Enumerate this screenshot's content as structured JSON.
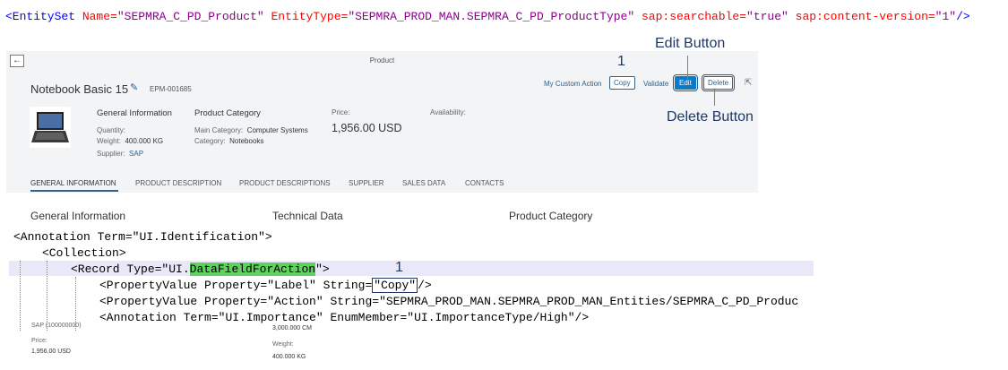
{
  "top_xml": {
    "tag": "<EntitySet",
    "name_attr": "Name=",
    "name_val": "\"SEPMRA_C_PD_Product\"",
    "type_attr": "EntityType=",
    "type_val": "\"SEPMRA_PROD_MAN.SEPMRA_C_PD_ProductType\"",
    "search_attr": "sap:searchable=",
    "search_val": "\"true\"",
    "version_attr": "sap:content-version=",
    "version_val": "\"1\"",
    "close": "/>"
  },
  "fiori": {
    "back_icon": "←",
    "page_header": "Product",
    "object_title": "Notebook Basic 15",
    "edit_pen_icon": "✎",
    "object_id": "EPM-001685",
    "general_info": {
      "title": "General Information",
      "quantity_label": "Quantity:",
      "weight_label": "Weight:",
      "weight_value": "400.000 KG",
      "supplier_label": "Supplier:",
      "supplier_value": "SAP"
    },
    "product_category": {
      "title": "Product Category",
      "main_category_label": "Main Category:",
      "main_category_value": "Computer Systems",
      "category_label": "Category:",
      "category_value": "Notebooks"
    },
    "price": {
      "label": "Price:",
      "value": "1,956.00  USD"
    },
    "availability": {
      "label": "Availability:"
    },
    "actions": {
      "custom_action": "My Custom Action",
      "copy": "Copy",
      "validate": "Validate",
      "edit": "Edit",
      "delete": "Delete"
    },
    "share_icon": "⇱",
    "tabs": [
      "GENERAL INFORMATION",
      "PRODUCT DESCRIPTION",
      "PRODUCT DESCRIPTIONS",
      "SUPPLIER",
      "SALES DATA",
      "CONTACTS"
    ]
  },
  "annotations": {
    "edit_button": "Edit Button",
    "delete_button": "Delete Button",
    "marker_top": "1",
    "marker_bottom": "1"
  },
  "sections": {
    "general_information": "General Information",
    "technical_data": "Technical Data",
    "product_category": "Product Category"
  },
  "xml_snippet": {
    "line1_tag": "<Annotation",
    "line1_attr": " Term=",
    "line1_val": "\"UI.Identification\"",
    "line1_close": ">",
    "line2": "<Collection>",
    "line3_tag": "<Record",
    "line3_attr": " Type=",
    "line3_val_a": "\"UI.",
    "line3_val_b": "DataFieldForAction",
    "line3_val_c": "\"",
    "line3_close": ">",
    "line4_tag": "<PropertyValue",
    "line4_attr1": " Property=",
    "line4_val1": "\"Label\"",
    "line4_attr2": " String=",
    "line4_val2": "\"Copy\"",
    "line4_close": "/>",
    "line5_tag": "<PropertyValue",
    "line5_attr1": " Property=",
    "line5_val1": "\"Action\"",
    "line5_attr2": " String=",
    "line5_val2": "\"SEPMRA_PROD_MAN.SEPMRA_PROD_MAN_Entities/SEPMRA_C_PD_Produc",
    "line6_tag": "<Annotation",
    "line6_attr1": " Term=",
    "line6_val1": "\"UI.Importance\"",
    "line6_attr2": " EnumMember=",
    "line6_val2": "\"UI.ImportanceType/High\"",
    "line6_close": "/>"
  },
  "bottom_faded": {
    "sap_text": "SAP (100000000)",
    "price_label": "Price:",
    "price_value": "1,956.00  USD",
    "cm_value": "3,000.000 CM",
    "weight_label": "Weight:",
    "weight_value": "400.000 KG"
  }
}
